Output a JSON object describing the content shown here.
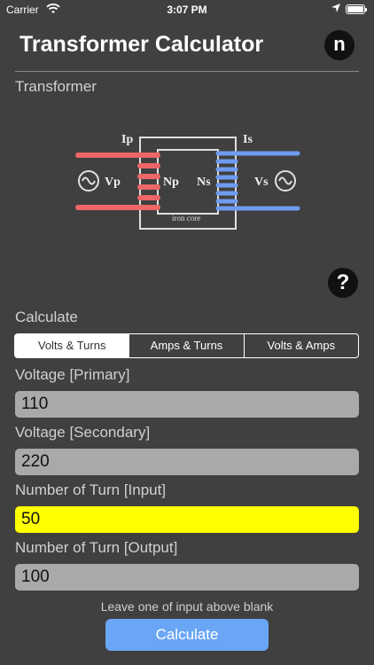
{
  "status": {
    "carrier": "Carrier",
    "time": "3:07 PM"
  },
  "header": {
    "title": "Transformer Calculator",
    "logo": "n"
  },
  "sections": {
    "transformer": "Transformer",
    "calculate": "Calculate"
  },
  "diagram": {
    "ip": "Ip",
    "is": "Is",
    "vp": "Vp",
    "vs": "Vs",
    "np": "Np",
    "ns": "Ns",
    "core": "iron core",
    "primary_color": "#ee6666",
    "secondary_color": "#6f9cf0"
  },
  "help": {
    "label": "?"
  },
  "tabs": [
    {
      "label": "Volts & Turns",
      "active": true
    },
    {
      "label": "Amps & Turns",
      "active": false
    },
    {
      "label": "Volts & Amps",
      "active": false
    }
  ],
  "fields": [
    {
      "label": "Voltage [Primary]",
      "value": "110"
    },
    {
      "label": "Voltage [Secondary]",
      "value": "220"
    },
    {
      "label": "Number of Turn [Input]",
      "value": "50"
    },
    {
      "label": "Number of Turn [Output]",
      "value": "100"
    }
  ],
  "hint": "Leave one of input above blank",
  "button": {
    "label": "Calculate"
  }
}
